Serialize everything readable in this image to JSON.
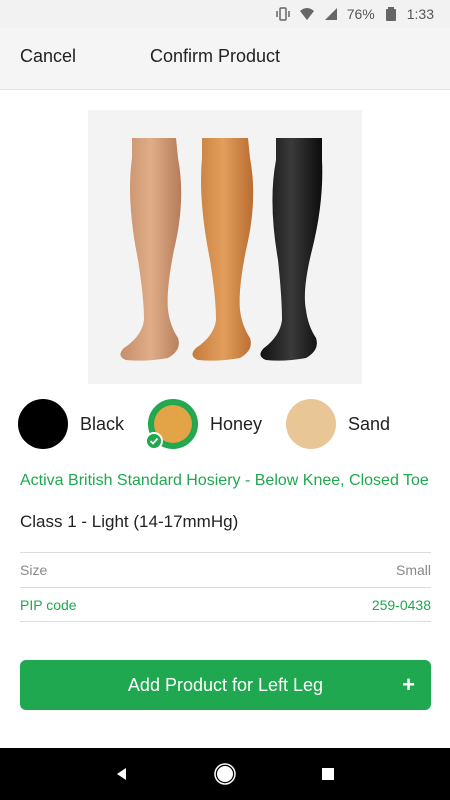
{
  "status_bar": {
    "battery": "76%",
    "time": "1:33",
    "icons": [
      "vibrate-icon",
      "wifi-icon",
      "signal-icon",
      "battery-icon"
    ]
  },
  "header": {
    "cancel_label": "Cancel",
    "title": "Confirm Product"
  },
  "colors": {
    "options": [
      {
        "label": "Black",
        "hex": "#000000",
        "selected": false
      },
      {
        "label": "Honey",
        "hex": "#e2a447",
        "selected": true
      },
      {
        "label": "Sand",
        "hex": "#e9c696",
        "selected": false
      }
    ],
    "accent": "#1fa84f"
  },
  "product": {
    "name": "Activa British Standard Hosiery - Below Knee, Closed Toe",
    "class": "Class 1 - Light (14-17mmHg)"
  },
  "info": {
    "size_label": "Size",
    "size_value": "Small",
    "pip_label": "PIP code",
    "pip_value": "259-0438"
  },
  "add_button": {
    "label": "Add Product for Left Leg",
    "icon": "plus-icon"
  },
  "nav": {
    "icons": [
      "back-icon",
      "home-icon",
      "recents-icon"
    ]
  }
}
